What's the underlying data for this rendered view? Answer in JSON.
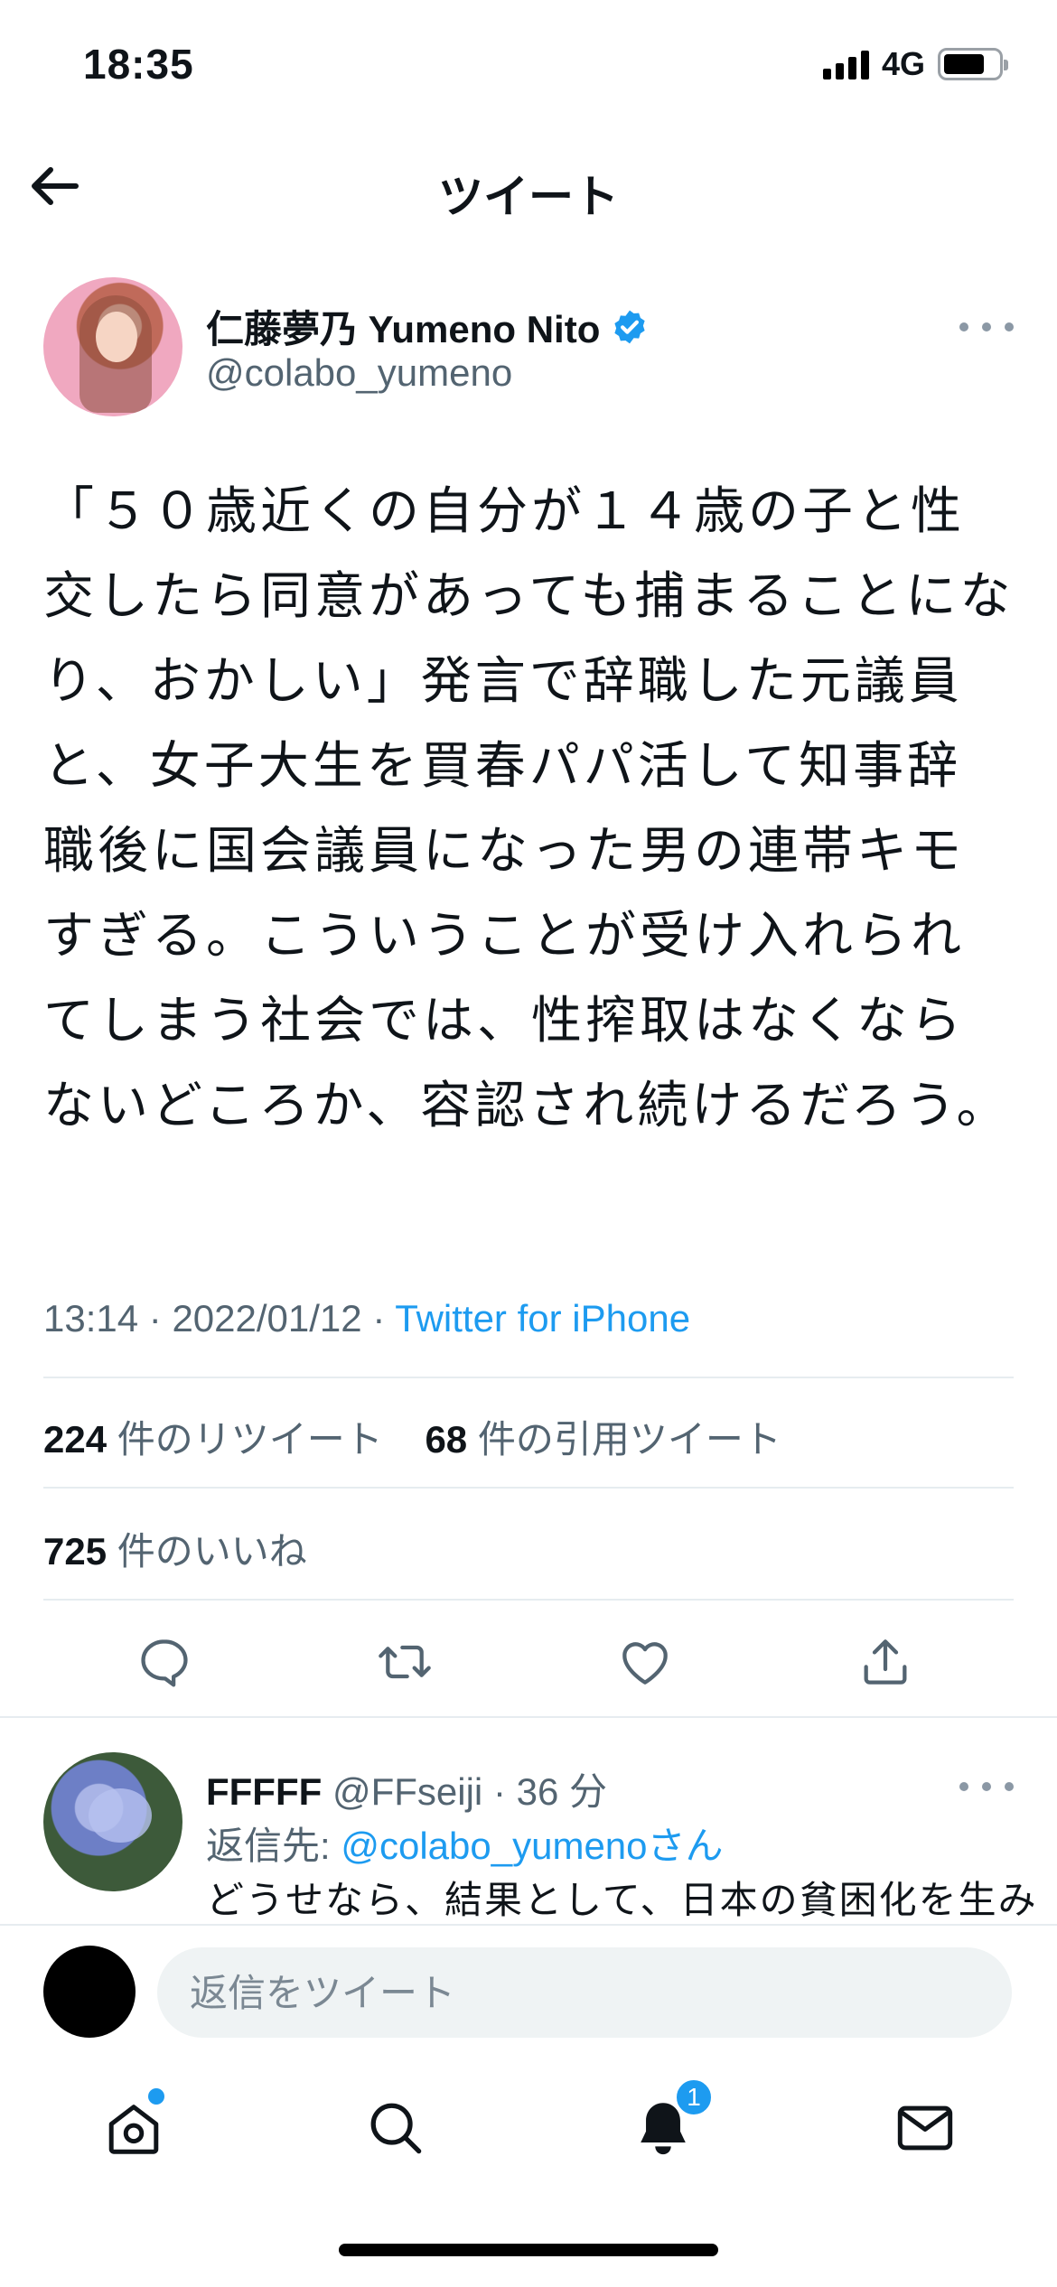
{
  "status_bar": {
    "time": "18:35",
    "network": "4G"
  },
  "header": {
    "title": "ツイート"
  },
  "tweet": {
    "display_name": "仁藤夢乃 Yumeno Nito",
    "handle": "@colabo_yumeno",
    "text": "「５０歳近くの自分が１４歳の子と性交したら同意があっても捕まることになり、おかしい」発言で辞職した元議員と、女子大生を買春パパ活して知事辞職後に国会議員になった男の連帯キモすぎる。こういうことが受け入れられてしまう社会では、性搾取はなくならないどころか、容認され続けるだろう。",
    "time": "13:14",
    "date": "2022/01/12",
    "source": "Twitter for iPhone",
    "retweets": "224",
    "retweets_label": "件のリツイート",
    "quotes": "68",
    "quotes_label": "件の引用ツイート",
    "likes": "725",
    "likes_label": "件のいいね"
  },
  "reply": {
    "name": "FFFFF",
    "handle": "@FFseiji",
    "time": "36 分",
    "reply_to_label": "返信先: ",
    "reply_to_handle": "@colabo_yumeno",
    "reply_to_suffix": "さん",
    "text": "どうせなら、結果として、日本の貧困化を生み"
  },
  "compose": {
    "placeholder": "返信をツイート"
  },
  "tabbar": {
    "notifications_badge": "1"
  },
  "colors": {
    "accent": "#1d9bf0",
    "muted": "#536471",
    "divider": "#e6ecf0"
  },
  "icons": [
    "back-arrow-icon",
    "verified-badge-icon",
    "more-icon",
    "reply-icon",
    "retweet-icon",
    "like-icon",
    "share-icon",
    "home-icon",
    "search-icon",
    "bell-icon",
    "mail-icon"
  ]
}
